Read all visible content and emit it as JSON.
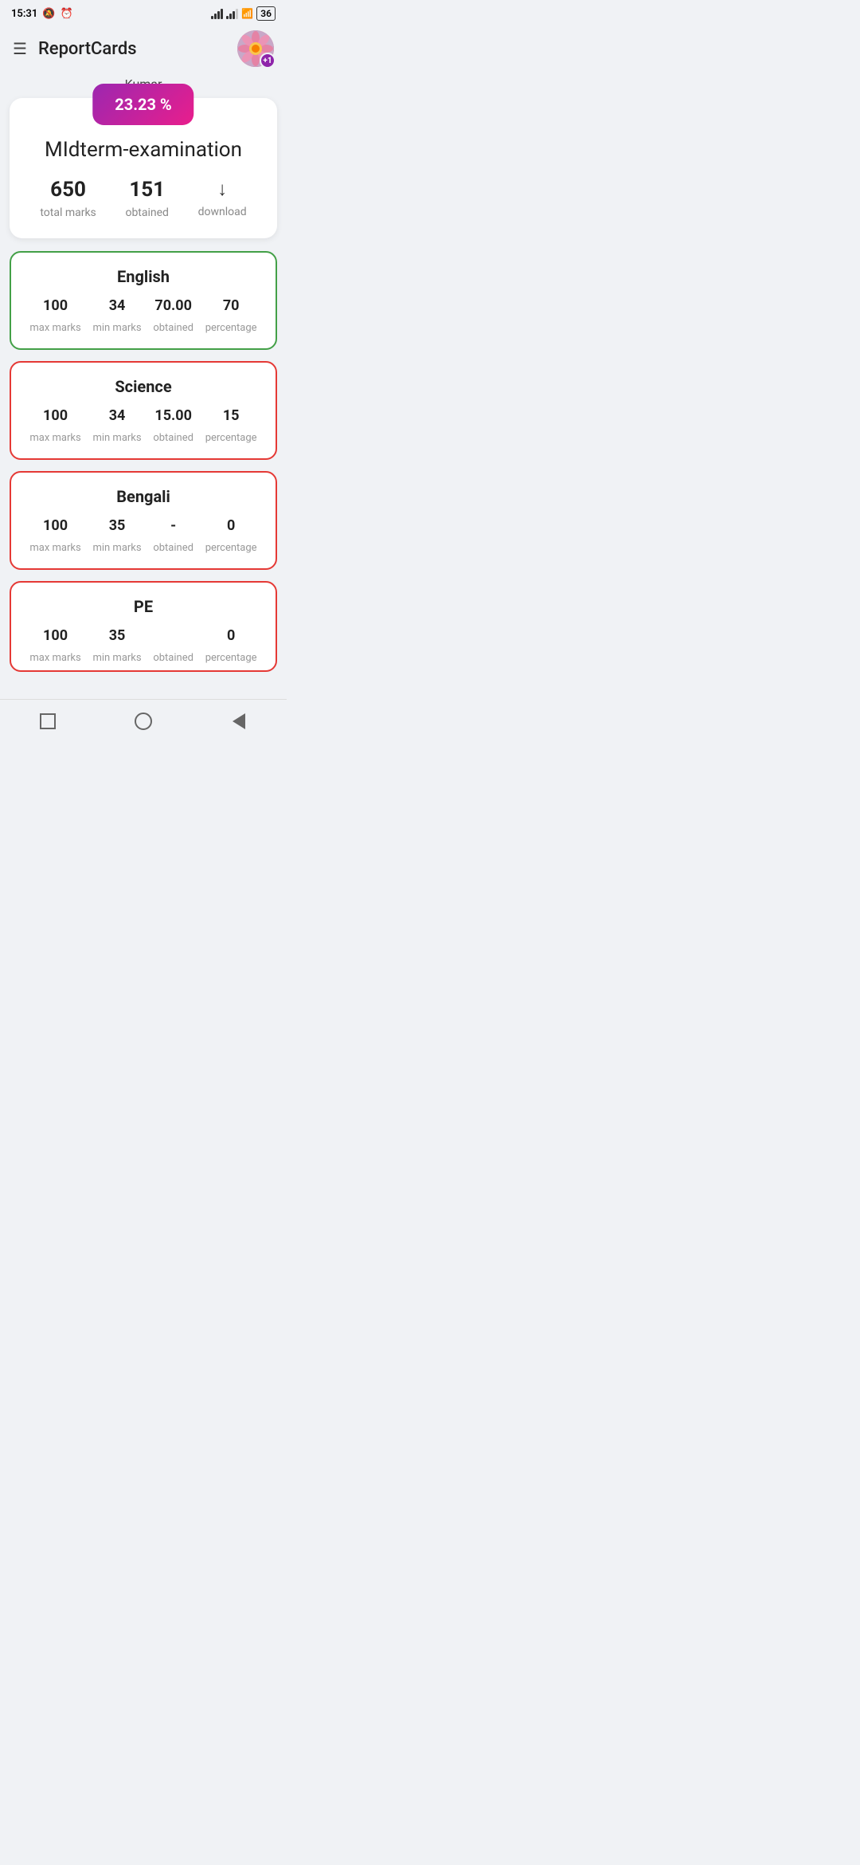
{
  "statusBar": {
    "time": "15:31",
    "battery": "36"
  },
  "header": {
    "title": "ReportCards",
    "avatarBadge": "+1"
  },
  "student": {
    "name": "Kumar"
  },
  "summary": {
    "percentage": "23.23 %",
    "examTitle": "MIdterm-examination",
    "totalMarks": "650",
    "totalMarksLabel": "total marks",
    "obtained": "151",
    "obtainedLabel": "obtained",
    "downloadLabel": "download"
  },
  "subjects": [
    {
      "name": "English",
      "borderColor": "green",
      "maxMarks": "100",
      "minMarks": "34",
      "obtained": "70.00",
      "percentage": "70"
    },
    {
      "name": "Science",
      "borderColor": "red",
      "maxMarks": "100",
      "minMarks": "34",
      "obtained": "15.00",
      "percentage": "15"
    },
    {
      "name": "Bengali",
      "borderColor": "red",
      "maxMarks": "100",
      "minMarks": "35",
      "obtained": "-",
      "percentage": "0"
    },
    {
      "name": "PE",
      "borderColor": "red",
      "maxMarks": "100",
      "minMarks": "35",
      "obtained": "",
      "percentage": "0"
    }
  ],
  "subjectLabels": {
    "maxMarks": "max marks",
    "minMarks": "min marks",
    "obtained": "obtained",
    "percentage": "percentage"
  }
}
